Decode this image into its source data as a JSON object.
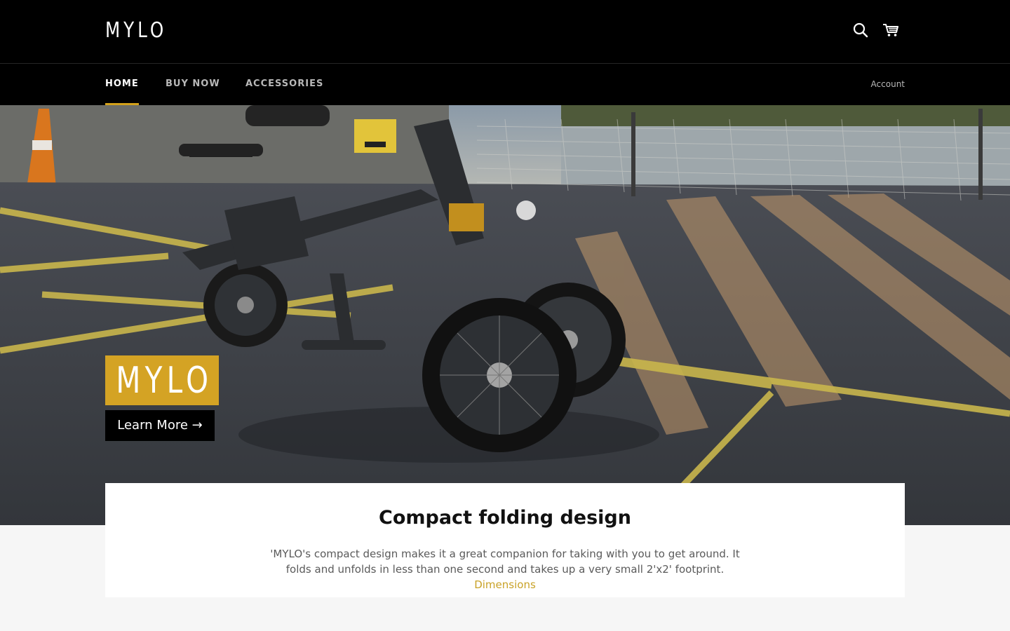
{
  "header": {
    "logo": "MYLO",
    "nav": [
      {
        "label": "HOME",
        "active": true
      },
      {
        "label": "BUY NOW",
        "active": false
      },
      {
        "label": "ACCESSORIES",
        "active": false
      }
    ],
    "account": "Account",
    "icons": [
      "search-icon",
      "cart-icon"
    ]
  },
  "hero": {
    "badge": "MYLO",
    "cta": "Learn More →"
  },
  "feature": {
    "title": "Compact folding design",
    "body": "'MYLO's compact design makes it a great companion for taking with you to get around. It folds and unfolds in less than one second and takes up a very small 2'x2' footprint. ",
    "link": "Dimensions"
  },
  "colors": {
    "accent": "#d4a324",
    "header_bg": "#000000",
    "page_bg": "#f6f6f6"
  }
}
